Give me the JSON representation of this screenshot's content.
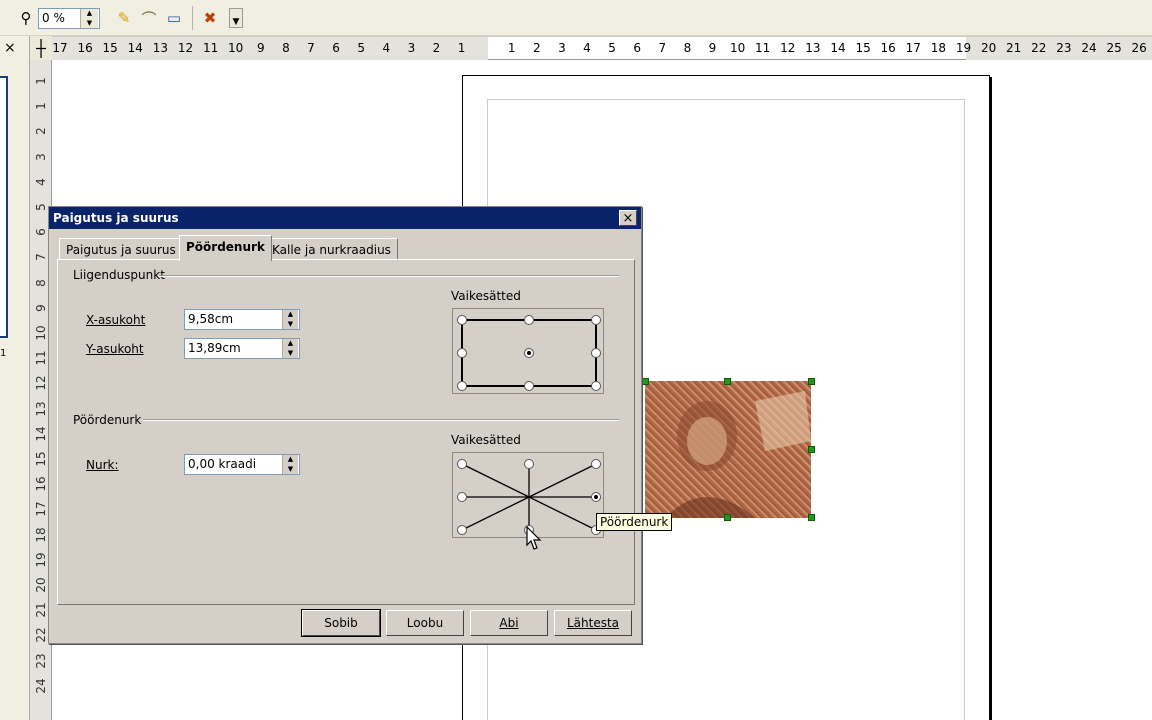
{
  "toolbar": {
    "zoom_value": "0 %",
    "icons": [
      "pin-icon",
      "pen-icon",
      "highlighter-icon",
      "monitor-icon",
      "cross-tool-icon",
      "more-icon"
    ]
  },
  "ruler_horizontal": {
    "ticks": [
      "17",
      "16",
      "15",
      "14",
      "13",
      "12",
      "11",
      "10",
      "9",
      "8",
      "7",
      "6",
      "5",
      "4",
      "3",
      "2",
      "1",
      "1",
      "2",
      "3",
      "4",
      "5",
      "6",
      "7",
      "8",
      "9",
      "10",
      "11",
      "12",
      "13",
      "14",
      "15",
      "16",
      "17",
      "18",
      "19",
      "20",
      "21",
      "22",
      "23",
      "24",
      "25",
      "26"
    ]
  },
  "ruler_vertical": {
    "ticks": [
      "1",
      "1",
      "2",
      "3",
      "4",
      "5",
      "6",
      "7",
      "8",
      "9",
      "10",
      "11",
      "12",
      "13",
      "14",
      "15",
      "16",
      "17",
      "18",
      "19",
      "20",
      "21",
      "22",
      "23",
      "24"
    ]
  },
  "left_panel": {
    "close_label": "×",
    "page_number": "1"
  },
  "dialog": {
    "title": "Paigutus ja suurus",
    "close_label": "×",
    "tabs": [
      {
        "label": "Paigutus ja suurus"
      },
      {
        "label": "Pöördenurk"
      },
      {
        "label": "Kalle ja nurkraadius"
      }
    ],
    "pivot": {
      "section_label": "Liigenduspunkt",
      "x_label": "X-asukoht",
      "x_value": "9,58cm",
      "y_label": "Y-asukoht",
      "y_value": "13,89cm",
      "defaults_label": "Vaikesätted"
    },
    "rotation": {
      "section_label": "Pöördenurk",
      "angle_label": "Nurk:",
      "angle_value": "0,00 kraadi",
      "defaults_label": "Vaikesätted"
    },
    "buttons": {
      "ok": "Sobib",
      "cancel": "Loobu",
      "help": "Abi",
      "reset": "Lähtesta"
    }
  },
  "tooltip": "Pöördenurk"
}
